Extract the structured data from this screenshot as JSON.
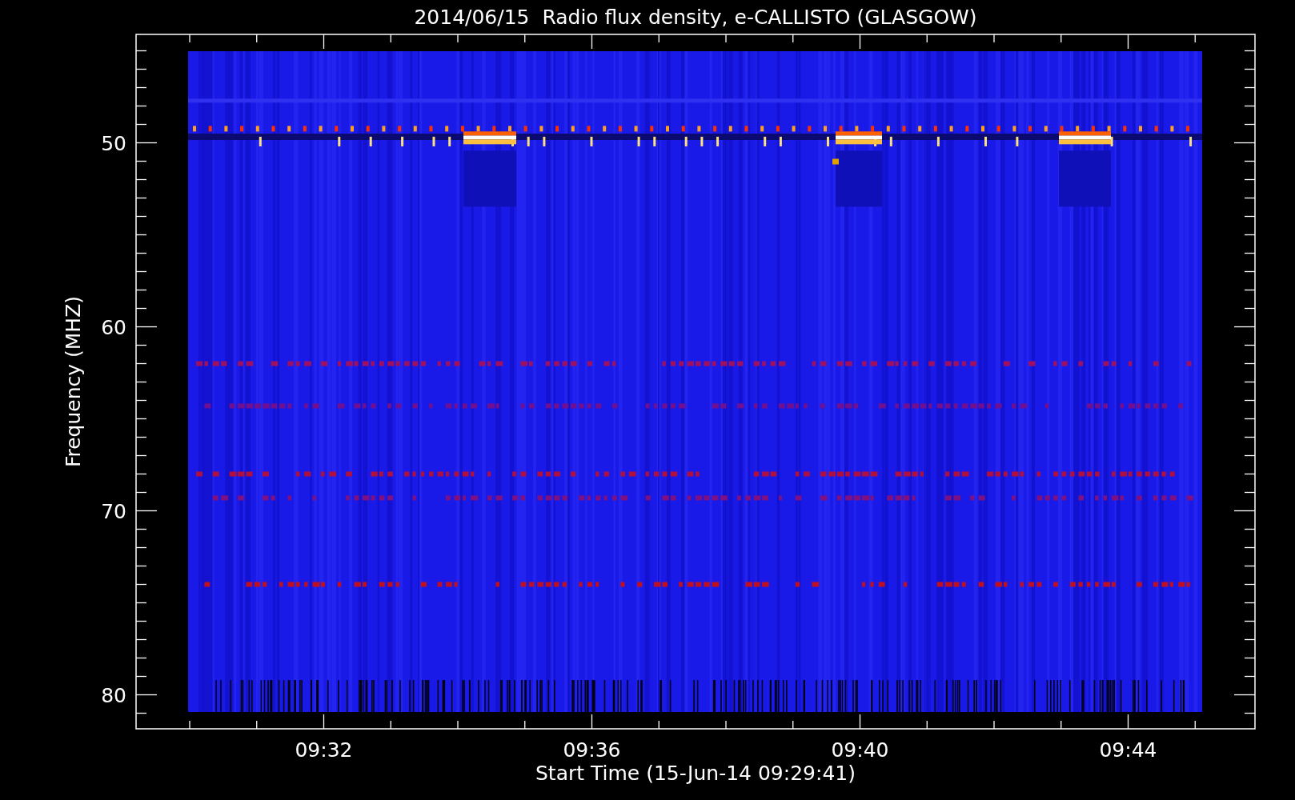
{
  "plot": {
    "title": "2014/06/15  Radio flux density, e-CALLISTO (GLASGOW)",
    "y_axis": {
      "label": "Frequency (MHZ)",
      "tick_labels": [
        "50",
        "60",
        "70",
        "80"
      ]
    },
    "x_axis": {
      "label": "Start Time (15-Jun-14 09:29:41)",
      "tick_labels": [
        "09:32",
        "09:36",
        "09:40",
        "09:44"
      ]
    }
  }
}
